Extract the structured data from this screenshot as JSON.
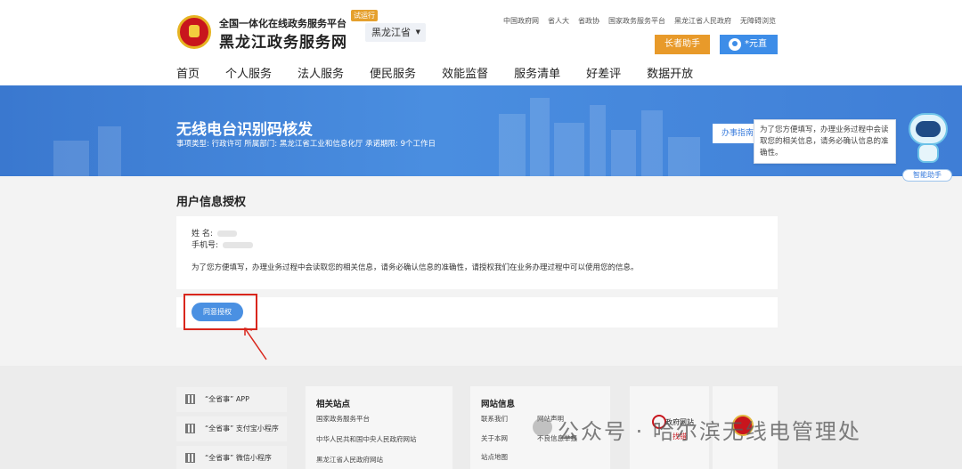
{
  "header": {
    "site_subtitle": "全国一体化在线政务服务平台",
    "site_title": "黑龙江政务服务网",
    "trial_badge": "试运行",
    "province": "黑龙江省",
    "top_links": [
      "中国政府网",
      "省人大",
      "省政协",
      "国家政务服务平台",
      "黑龙江省人民政府",
      "无障碍浏览"
    ],
    "elder_assistant": "长者助手",
    "user_name": "*元直"
  },
  "nav": {
    "items": [
      "首页",
      "个人服务",
      "法人服务",
      "便民服务",
      "效能监督",
      "服务清单",
      "好差评",
      "数据开放"
    ]
  },
  "service": {
    "title": "无线电台识别码核发",
    "meta": "事项类型: 行政许可   所属部门: 黑龙江省工业和信息化厅   承诺期限: 9个工作日",
    "guide_button": "办事指南",
    "tooltip": "为了您方便填写，办理业务过程中会读取您的相关信息，请务必确认信息的准确性。",
    "assistant_button": "智能助手"
  },
  "auth": {
    "heading": "用户信息授权",
    "name_label": "姓    名:",
    "phone_label": "手机号:",
    "note": "为了您方便填写，办理业务过程中会读取您的相关信息，请务必确认信息的准确性，请授权我们在业务办理过程中可以使用您的信息。",
    "agree_button": "同意授权"
  },
  "footer": {
    "apps": [
      "“全省事” APP",
      "“全省事” 支付宝小程序",
      "“全省事” 微信小程序"
    ],
    "related_title": "相关站点",
    "related_links": [
      "国家政务服务平台",
      "中华人民共和国中央人民政府网站",
      "黑龙江省人民政府网站"
    ],
    "siteinfo_title": "网站信息",
    "siteinfo_links_a": [
      "联系我们",
      "关于本网",
      "站点地图"
    ],
    "siteinfo_links_b": [
      "网站声明",
      "不良信息举报"
    ],
    "gov_badge": "政府网站",
    "gov_badge_sub": "找错"
  },
  "watermark": "公众号 · 哈尔滨无线电管理处",
  "colors": {
    "brand_blue": "#3d8de8",
    "elder_orange": "#e89a2a",
    "highlight_red": "#d9261c"
  }
}
